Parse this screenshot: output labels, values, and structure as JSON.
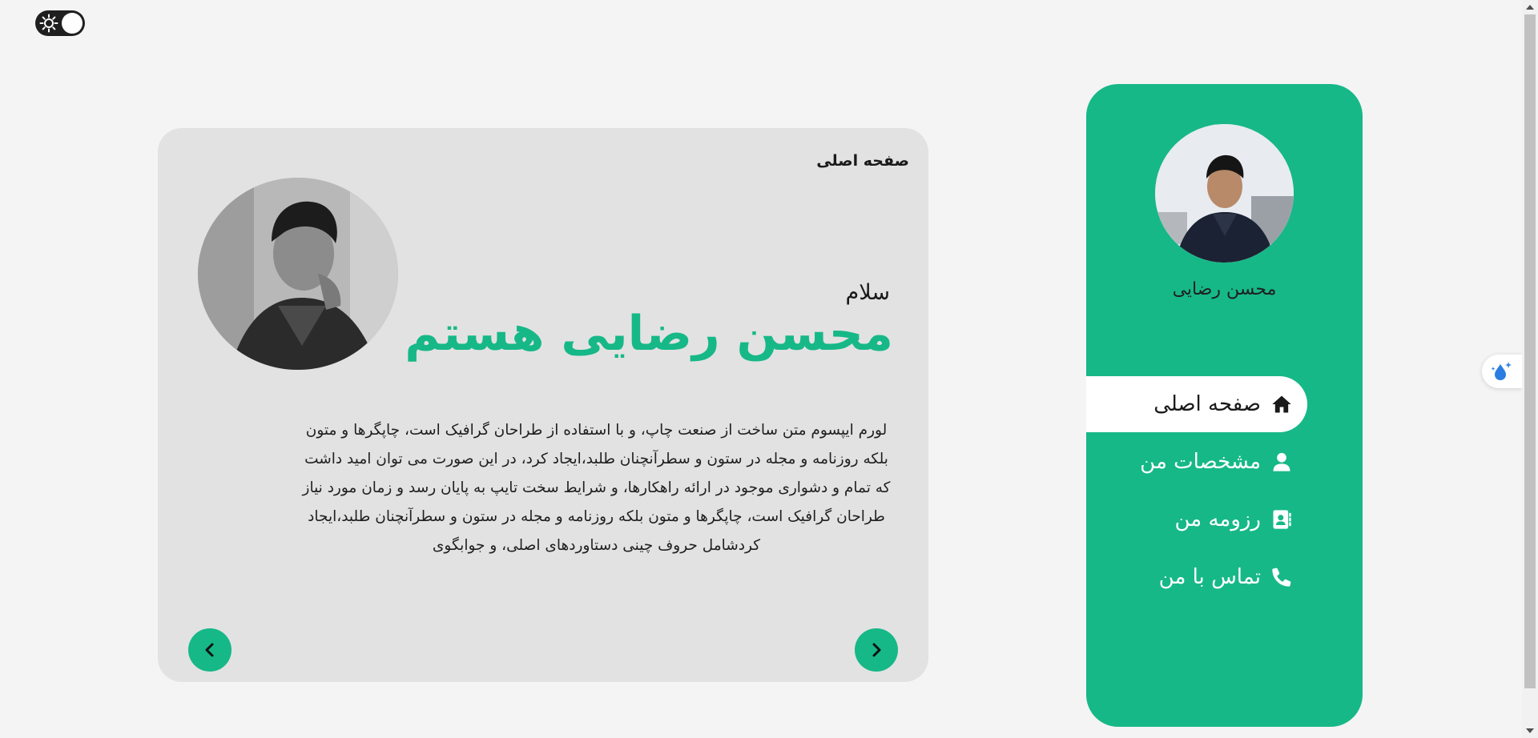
{
  "theme_toggle": {
    "icon": "sun-icon",
    "state": "light"
  },
  "main": {
    "breadcrumb": "صفحه اصلی",
    "greeting": "سلام",
    "headline": "محسن رضایی هستم",
    "bio": "لورم ایپسوم متن ساخت از صنعت چاپ، و با استفاده از طراحان گرافیک است، چاپگرها و متون بلکه روزنامه و مجله در ستون و سطرآنچنان طلبد،ایجاد کرد، در این صورت می توان امید داشت که تمام و دشواری موجود در ارائه راهکارها، و شرایط سخت تایپ به پایان رسد و زمان مورد نیاز طراحان گرافیک است، چاپگرها و متون بلکه روزنامه و مجله در ستون و سطرآنچنان طلبد،ایجاد کردشامل حروف چینی دستاوردهای اصلی، و جوابگوی",
    "prev_icon": "chevron-left-icon",
    "next_icon": "chevron-right-icon"
  },
  "sidebar": {
    "name": "محسن رضایی",
    "items": [
      {
        "label": "صفحه اصلی",
        "icon": "home-icon",
        "active": true
      },
      {
        "label": "مشخصات من",
        "icon": "user-icon",
        "active": false
      },
      {
        "label": "رزومه من",
        "icon": "contact-card-icon",
        "active": false
      },
      {
        "label": "تماس با من",
        "icon": "phone-icon",
        "active": false
      }
    ]
  },
  "colors": {
    "accent": "#16b887",
    "card": "#e2e2e2",
    "background": "#f4f4f4"
  }
}
